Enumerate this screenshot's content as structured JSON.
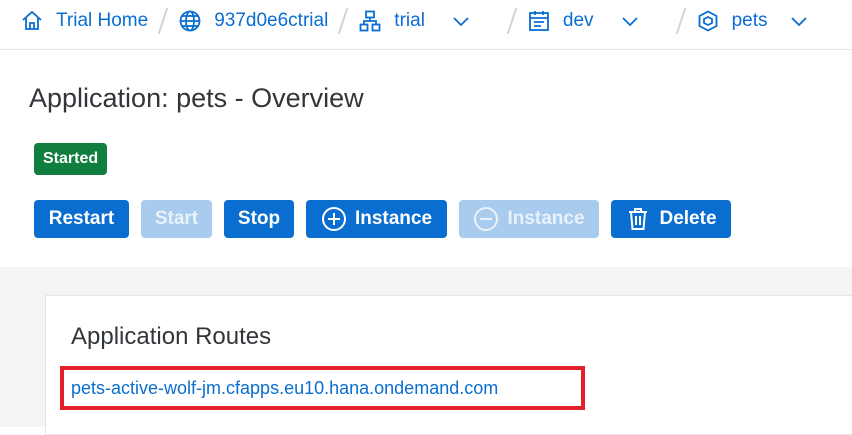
{
  "breadcrumb": {
    "items": [
      {
        "label": "Trial Home",
        "icon": "home-icon",
        "dropdown": false
      },
      {
        "label": "937d0e6ctrial",
        "icon": "globe-icon",
        "dropdown": false
      },
      {
        "label": "trial",
        "icon": "hierarchy-icon",
        "dropdown": true
      },
      {
        "label": "dev",
        "icon": "space-icon",
        "dropdown": true
      },
      {
        "label": "pets",
        "icon": "cube-icon",
        "dropdown": true
      }
    ]
  },
  "page": {
    "title": "Application: pets - Overview",
    "status": "Started",
    "status_color": "#107e3e"
  },
  "toolbar": {
    "restart": "Restart",
    "start": "Start",
    "stop": "Stop",
    "add_instance": "Instance",
    "remove_instance": "Instance",
    "delete": "Delete"
  },
  "routes": {
    "title": "Application Routes",
    "items": [
      "pets-active-wolf-jm.cfapps.eu10.hana.ondemand.com"
    ]
  },
  "colors": {
    "accent": "#0a6ed1",
    "disabled": "#a8cbee",
    "highlight": "#e3202b"
  }
}
